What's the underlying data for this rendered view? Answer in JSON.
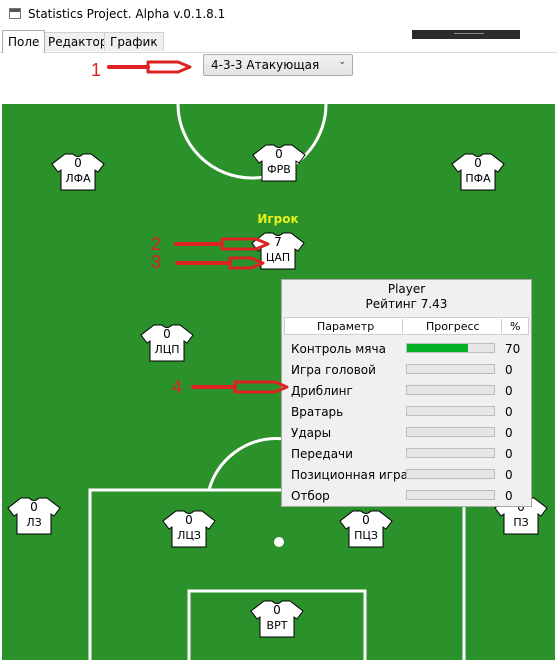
{
  "window": {
    "title": "Statistics Project. Alpha v.0.1.8.1"
  },
  "tabs": [
    {
      "label": "Поле"
    },
    {
      "label": "Редактор"
    },
    {
      "label": "График"
    }
  ],
  "formation": {
    "selected": "4-3-3 Атакующая"
  },
  "annotations": [
    "1",
    "2",
    "3",
    "4"
  ],
  "colors": {
    "pitch": "#2b912b",
    "annotation": "#dd2222",
    "selected_player_label": "#e6f21a",
    "progress_fill": "#06b025"
  },
  "players": [
    {
      "number": "0",
      "position": "ЛФА"
    },
    {
      "number": "0",
      "position": "ФРВ"
    },
    {
      "number": "0",
      "position": "ПФА"
    },
    {
      "number": "7",
      "position": "ЦАП"
    },
    {
      "number": "0",
      "position": "ЛЦП"
    },
    {
      "number": "0",
      "position": "ЛЗ"
    },
    {
      "number": "0",
      "position": "ЛЦЗ"
    },
    {
      "number": "0",
      "position": "ПЦЗ"
    },
    {
      "number": "0",
      "position": "ПЗ"
    },
    {
      "number": "0",
      "position": "ВРТ"
    }
  ],
  "selected_player_label": "Игрок",
  "player_panel": {
    "name": "Player",
    "rating": "Рейтинг 7.43",
    "columns": [
      "Параметр",
      "Прогресс",
      "%"
    ],
    "rows": [
      {
        "param": "Контроль мяча",
        "percent": "70",
        "progress": 70
      },
      {
        "param": "Игра головой",
        "percent": "0",
        "progress": 0
      },
      {
        "param": "Дриблинг",
        "percent": "0",
        "progress": 0
      },
      {
        "param": "Вратарь",
        "percent": "0",
        "progress": 0
      },
      {
        "param": "Удары",
        "percent": "0",
        "progress": 0
      },
      {
        "param": "Передачи",
        "percent": "0",
        "progress": 0
      },
      {
        "param": "Позиционная игра",
        "percent": "0",
        "progress": 0
      },
      {
        "param": "Отбор",
        "percent": "0",
        "progress": 0
      }
    ]
  }
}
